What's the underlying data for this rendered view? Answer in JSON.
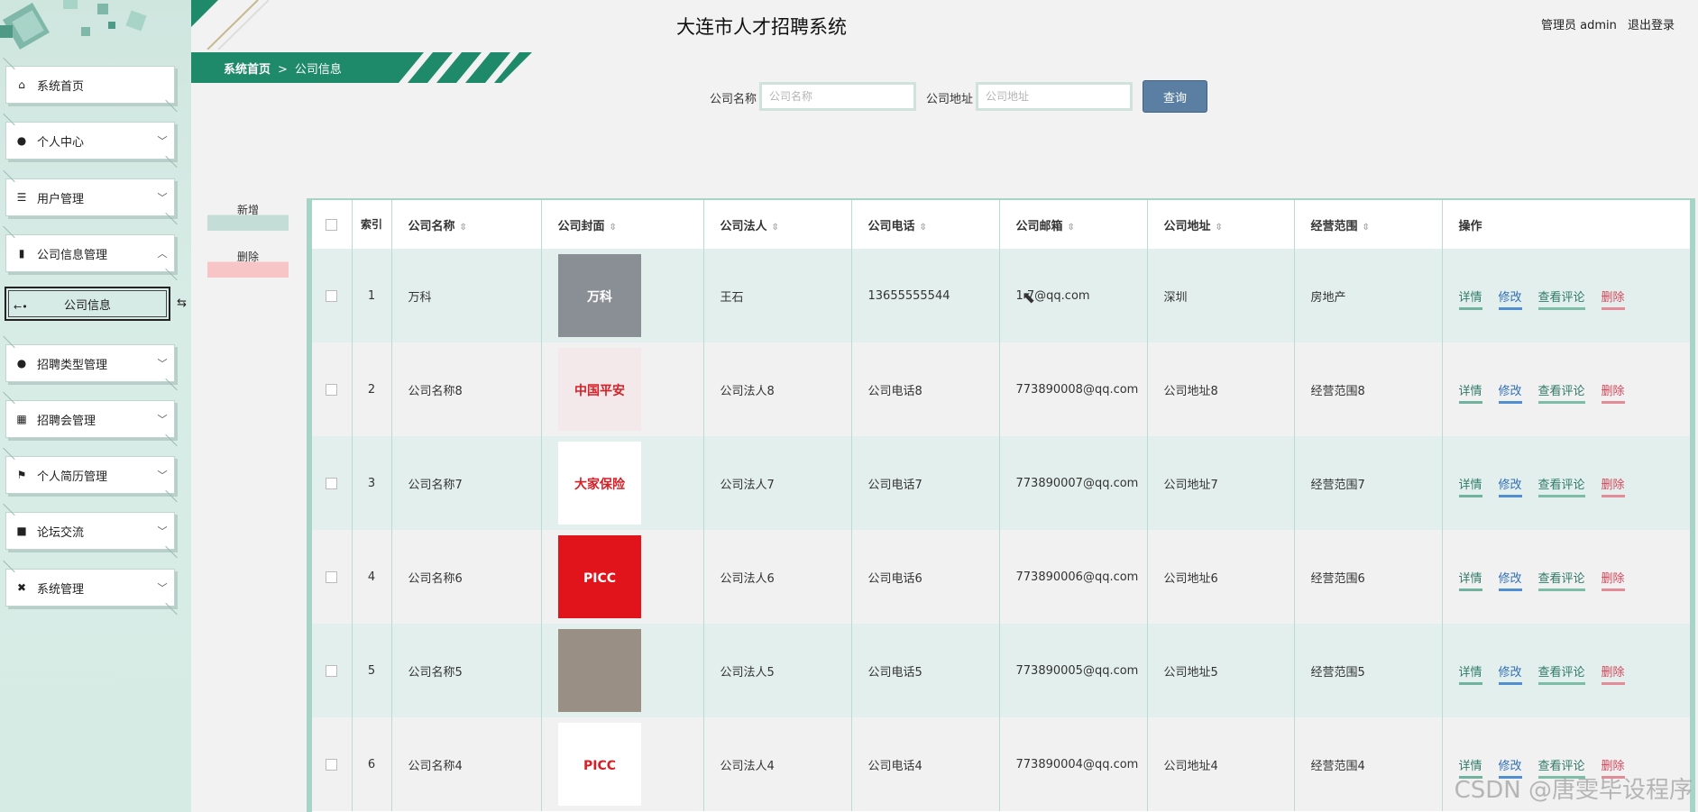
{
  "header": {
    "title": "大连市人才招聘系统",
    "user_label": "管理员 admin",
    "logout_label": "退出登录"
  },
  "breadcrumb": {
    "home": "系统首页",
    "separator": ">",
    "current": "公司信息"
  },
  "sidebar": {
    "items": [
      {
        "label": "系统首页",
        "icon": "home-icon",
        "glyph": "⌂"
      },
      {
        "label": "个人中心",
        "icon": "user-icon",
        "glyph": "●"
      },
      {
        "label": "用户管理",
        "icon": "list-icon",
        "glyph": "☰"
      },
      {
        "label": "公司信息管理",
        "icon": "bar-chart-icon",
        "glyph": "▮"
      },
      {
        "label": "招聘类型管理",
        "icon": "person-icon",
        "glyph": "●"
      },
      {
        "label": "招聘会管理",
        "icon": "grid-icon",
        "glyph": "▦"
      },
      {
        "label": "个人简历管理",
        "icon": "flag-icon",
        "glyph": "⚑"
      },
      {
        "label": "论坛交流",
        "icon": "thumb-icon",
        "glyph": "■"
      },
      {
        "label": "系统管理",
        "icon": "tools-icon",
        "glyph": "✖"
      }
    ],
    "sub_item": "公司信息"
  },
  "search": {
    "name_label": "公司名称",
    "name_placeholder": "公司名称",
    "addr_label": "公司地址",
    "addr_placeholder": "公司地址",
    "button": "查询"
  },
  "actions": {
    "add": "新增",
    "delete": "删除"
  },
  "table": {
    "headers": {
      "index": "索引",
      "name": "公司名称",
      "cover": "公司封面",
      "legal": "公司法人",
      "phone": "公司电话",
      "email": "公司邮箱",
      "address": "公司地址",
      "scope": "经营范围",
      "ops": "操作"
    },
    "ops": {
      "detail": "详情",
      "edit": "修改",
      "comments": "查看评论",
      "delete": "删除"
    },
    "rows": [
      {
        "index": "1",
        "name": "万科",
        "cover_text": "万科",
        "cover_color": "#8a8f96",
        "legal": "王石",
        "phone": "13655555544",
        "email": "1 7@qq.com",
        "address": "深圳",
        "scope": "房地产"
      },
      {
        "index": "2",
        "name": "公司名称8",
        "cover_text": "中国平安",
        "cover_color": "#f3e9ea",
        "legal": "公司法人8",
        "phone": "公司电话8",
        "email": "773890008@qq.com",
        "address": "公司地址8",
        "scope": "经营范围8"
      },
      {
        "index": "3",
        "name": "公司名称7",
        "cover_text": "大家保险",
        "cover_color": "#ffffff",
        "legal": "公司法人7",
        "phone": "公司电话7",
        "email": "773890007@qq.com",
        "address": "公司地址7",
        "scope": "经营范围7"
      },
      {
        "index": "4",
        "name": "公司名称6",
        "cover_text": "PICC",
        "cover_color": "#e2141b",
        "legal": "公司法人6",
        "phone": "公司电话6",
        "email": "773890006@qq.com",
        "address": "公司地址6",
        "scope": "经营范围6"
      },
      {
        "index": "5",
        "name": "公司名称5",
        "cover_text": "",
        "cover_color": "#9a8f85",
        "legal": "公司法人5",
        "phone": "公司电话5",
        "email": "773890005@qq.com",
        "address": "公司地址5",
        "scope": "经营范围5"
      },
      {
        "index": "6",
        "name": "公司名称4",
        "cover_text": "PICC",
        "cover_color": "#ffffff",
        "legal": "公司法人4",
        "phone": "公司电话4",
        "email": "773890004@qq.com",
        "address": "公司地址4",
        "scope": "经营范围4"
      }
    ]
  },
  "watermark": "CSDN @唐雯毕设程序"
}
